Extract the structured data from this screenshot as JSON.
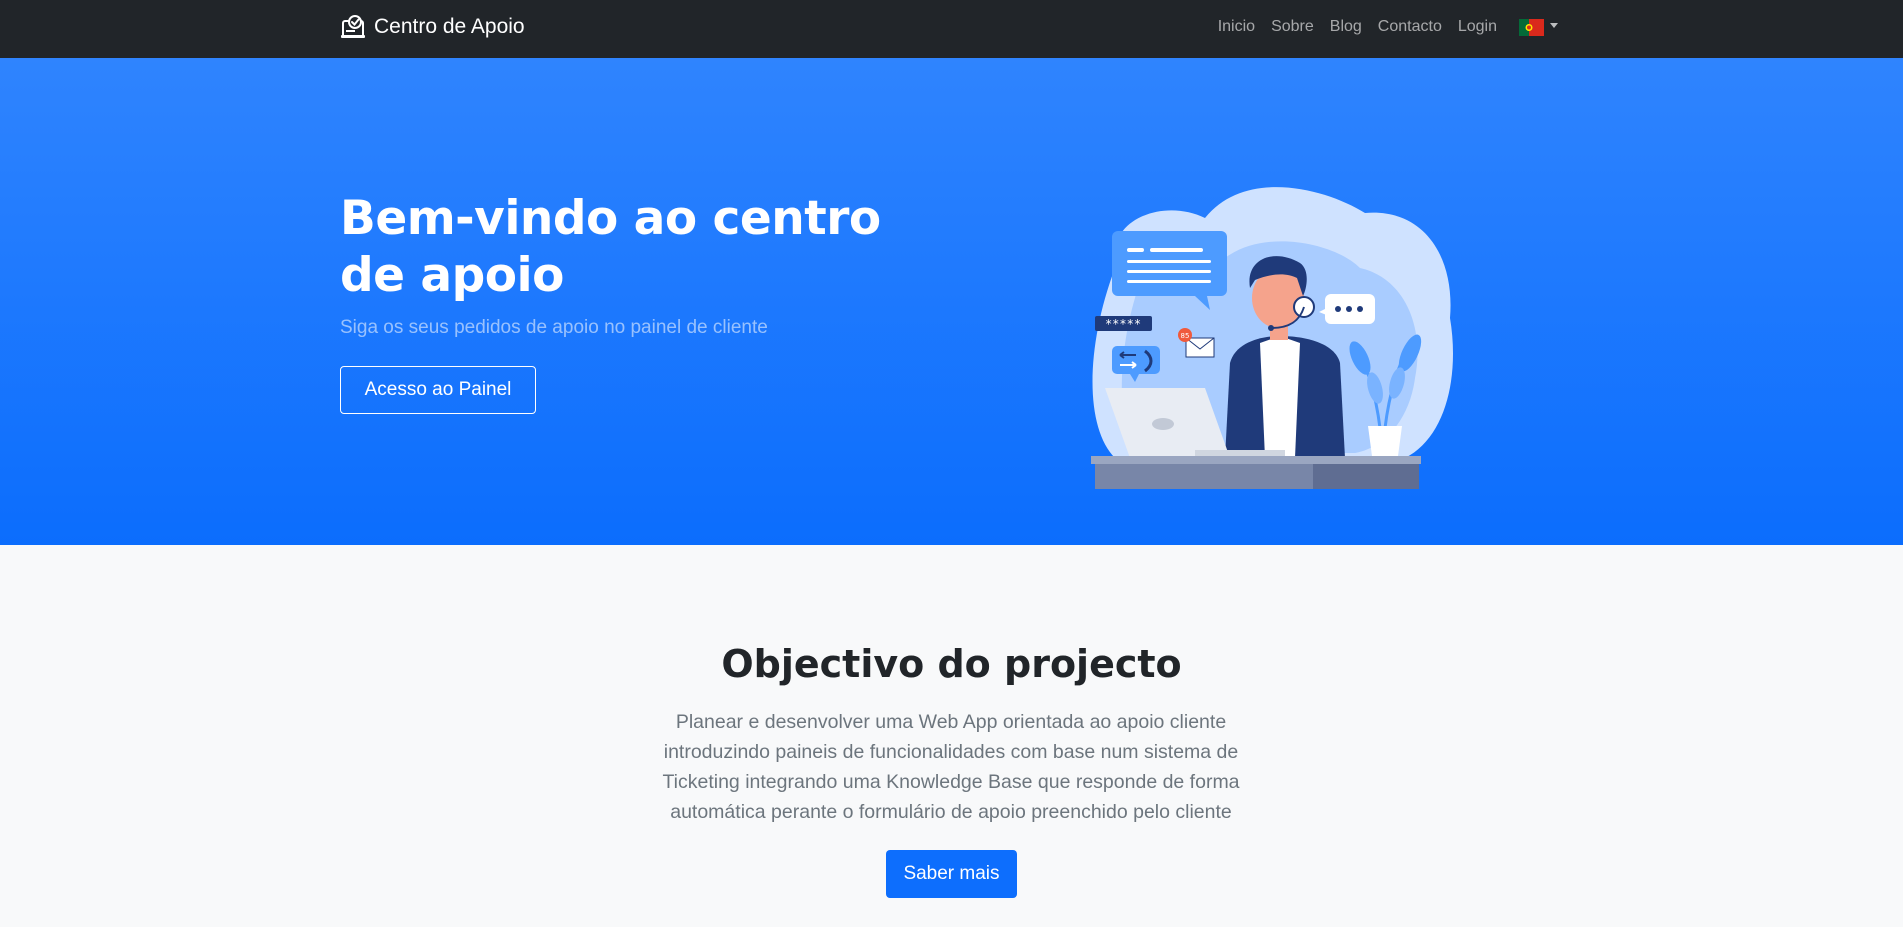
{
  "colors": {
    "navbar_bg": "#212529",
    "hero_gradient_top": "#2f84fe",
    "hero_gradient_bottom": "#0b6dfd",
    "page_bg": "#f8f9fa",
    "primary": "#0d6efd",
    "muted_text": "#6c757d"
  },
  "navbar": {
    "brand": {
      "icon": "support-ticket-icon",
      "label": "Centro de Apoio"
    },
    "links": [
      {
        "label": "Inicio"
      },
      {
        "label": "Sobre"
      },
      {
        "label": "Blog"
      },
      {
        "label": "Contacto"
      },
      {
        "label": "Login"
      }
    ],
    "language": {
      "icon": "portugal-flag-icon"
    }
  },
  "hero": {
    "title": "Bem-vindo ao centro de apoio",
    "subtitle": "Siga os seus pedidos de apoio no painel de cliente",
    "button_label": "Acesso ao Painel",
    "illustration": {
      "icon": "customer-support-agent-illustration",
      "password_label": "*****",
      "notification_count": "85"
    }
  },
  "objective": {
    "title": "Objectivo do projecto",
    "text": "Planear e desenvolver uma Web App orientada ao apoio cliente introduzindo paineis de funcionalidades com base num sistema de Ticketing integrando uma Knowledge Base que responde de forma automática perante o formulário de apoio preenchido pelo cliente",
    "button_label": "Saber mais"
  }
}
